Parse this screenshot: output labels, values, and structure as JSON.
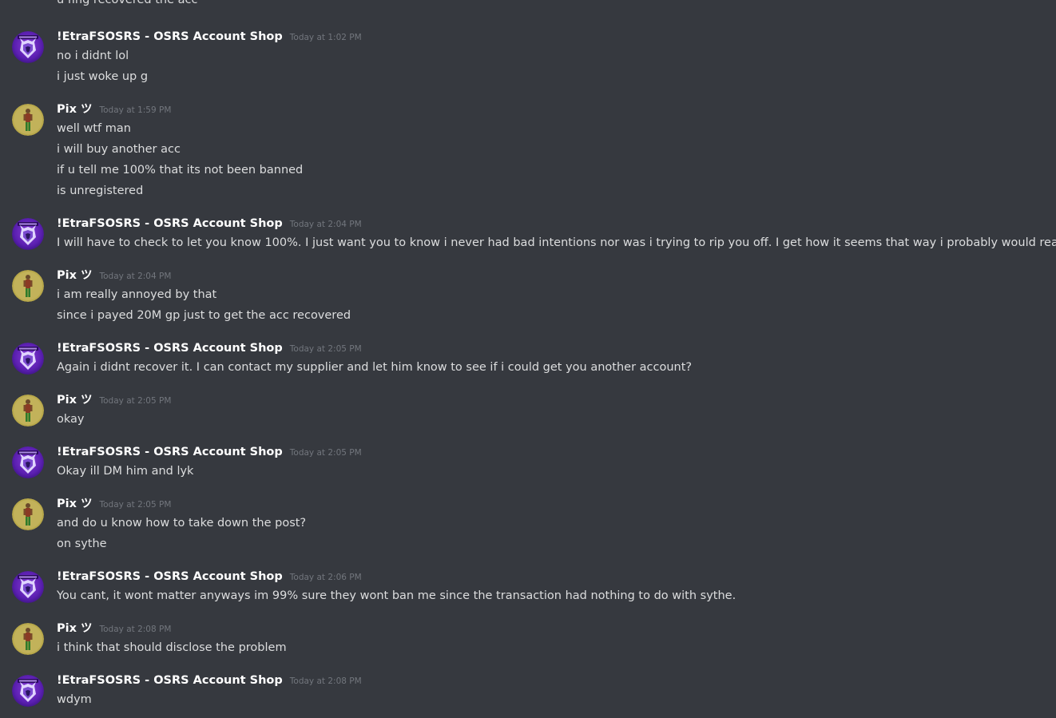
{
  "colors": {
    "background": "#36393f",
    "text": "#dcddde",
    "username": "#ffffff",
    "timestamp": "#72767d"
  },
  "truncated_previous_line": "u fing recovered the acc",
  "messages": [
    {
      "author": "!EtraFSOSRS - OSRS Account Shop",
      "avatar": "etra-wolf-avatar",
      "timestamp": "Today at 1:02 PM",
      "lines": [
        "no i didnt lol",
        "i just woke up g"
      ]
    },
    {
      "author": "Pix ツ",
      "avatar": "pix-character-avatar",
      "timestamp": "Today at 1:59 PM",
      "lines": [
        "well wtf man",
        "i will buy another acc",
        "if u tell me 100% that its not been banned",
        "is unregistered"
      ]
    },
    {
      "author": "!EtraFSOSRS - OSRS Account Shop",
      "avatar": "etra-wolf-avatar",
      "timestamp": "Today at 2:04 PM",
      "lines": [
        "I will have to check to let you know 100%. I just want you to know i never had bad intentions nor was i trying to rip you off. I get how it seems that way i probably would react the same way."
      ]
    },
    {
      "author": "Pix ツ",
      "avatar": "pix-character-avatar",
      "timestamp": "Today at 2:04 PM",
      "lines": [
        "i am really annoyed by that",
        "since i payed 20M gp just to get the acc recovered"
      ]
    },
    {
      "author": "!EtraFSOSRS - OSRS Account Shop",
      "avatar": "etra-wolf-avatar",
      "timestamp": "Today at 2:05 PM",
      "lines": [
        "Again i didnt recover it. I can contact my supplier and let him know to see if i could get you another account?"
      ]
    },
    {
      "author": "Pix ツ",
      "avatar": "pix-character-avatar",
      "timestamp": "Today at 2:05 PM",
      "lines": [
        "okay"
      ]
    },
    {
      "author": "!EtraFSOSRS - OSRS Account Shop",
      "avatar": "etra-wolf-avatar",
      "timestamp": "Today at 2:05 PM",
      "lines": [
        "Okay ill DM him and lyk"
      ]
    },
    {
      "author": "Pix ツ",
      "avatar": "pix-character-avatar",
      "timestamp": "Today at 2:05 PM",
      "lines": [
        "and do u know how to take down the post?",
        "on sythe"
      ]
    },
    {
      "author": "!EtraFSOSRS - OSRS Account Shop",
      "avatar": "etra-wolf-avatar",
      "timestamp": "Today at 2:06 PM",
      "lines": [
        "You cant, it wont matter anyways im 99% sure they wont ban me since the transaction had nothing to do with sythe."
      ]
    },
    {
      "author": "Pix ツ",
      "avatar": "pix-character-avatar",
      "timestamp": "Today at 2:08 PM",
      "lines": [
        "i think that should disclose the problem"
      ]
    },
    {
      "author": "!EtraFSOSRS - OSRS Account Shop",
      "avatar": "etra-wolf-avatar",
      "timestamp": "Today at 2:08 PM",
      "lines": [
        "wdym"
      ]
    }
  ]
}
